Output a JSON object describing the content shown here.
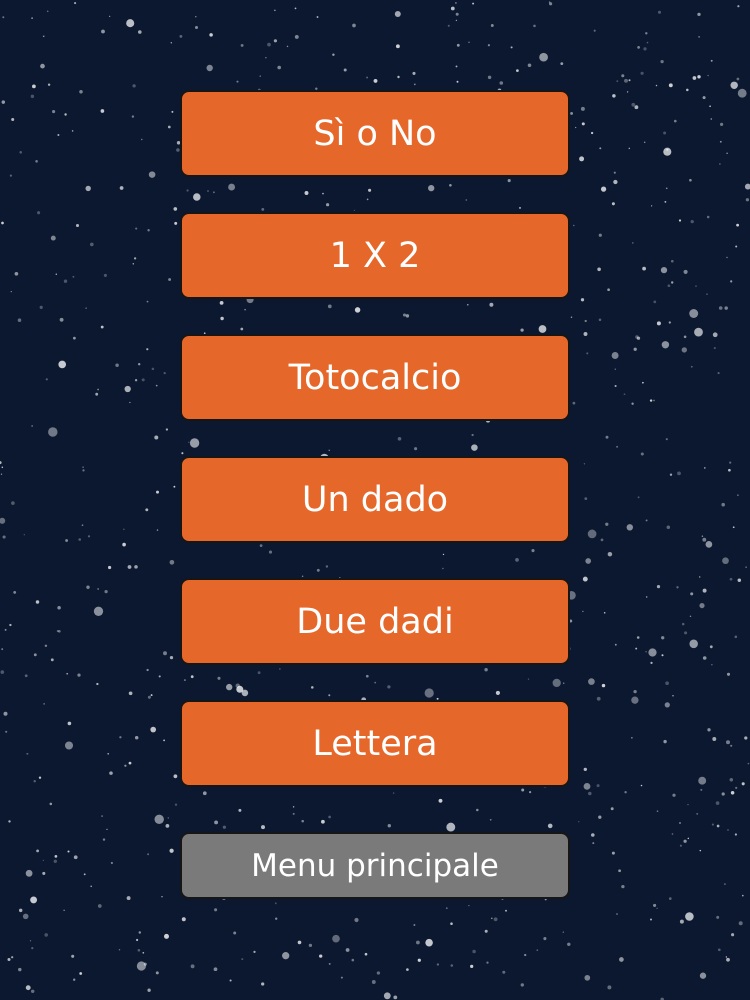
{
  "background": {
    "color": "#0b1830",
    "texture": "starry-night-dots"
  },
  "colors": {
    "primary_button": "#e6672a",
    "secondary_button": "#7a7a7a",
    "button_text": "#ffffff"
  },
  "menu": {
    "options": [
      {
        "label": "Sì o No"
      },
      {
        "label": "1 X 2"
      },
      {
        "label": "Totocalcio"
      },
      {
        "label": "Un dado"
      },
      {
        "label": "Due dadi"
      },
      {
        "label": "Lettera"
      }
    ],
    "main_menu_label": "Menu principale"
  }
}
